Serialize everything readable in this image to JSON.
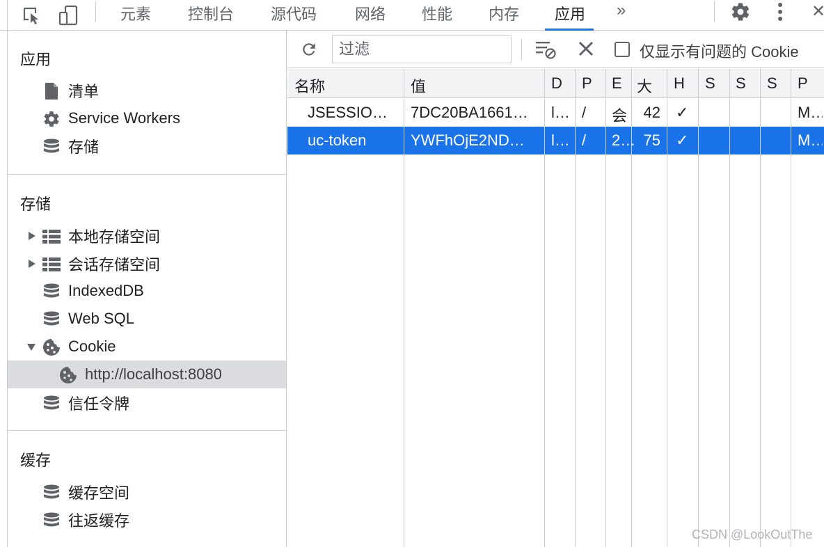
{
  "topbar": {
    "tabs": [
      "元素",
      "控制台",
      "源代码",
      "网络",
      "性能",
      "内存",
      "应用"
    ],
    "active_tab": "应用",
    "more": "»",
    "close": "✕"
  },
  "sidebar": {
    "app_section": {
      "title": "应用",
      "items": [
        {
          "label": "清单",
          "icon": "document-icon"
        },
        {
          "label": "Service Workers",
          "icon": "gear-icon"
        },
        {
          "label": "存储",
          "icon": "database-icon"
        }
      ]
    },
    "storage_section": {
      "title": "存储",
      "items": [
        {
          "label": "本地存储空间",
          "icon": "table-icon",
          "expander": "collapsed"
        },
        {
          "label": "会话存储空间",
          "icon": "table-icon",
          "expander": "collapsed"
        },
        {
          "label": "IndexedDB",
          "icon": "database-icon"
        },
        {
          "label": "Web SQL",
          "icon": "database-icon"
        },
        {
          "label": "Cookie",
          "icon": "cookie-icon",
          "expander": "expanded"
        },
        {
          "label": "http://localhost:8080",
          "icon": "cookie-icon",
          "selected": true
        },
        {
          "label": "信任令牌",
          "icon": "database-icon"
        }
      ]
    },
    "cache_section": {
      "title": "缓存",
      "items": [
        {
          "label": "缓存空间",
          "icon": "database-icon"
        },
        {
          "label": "往返缓存",
          "icon": "database-icon"
        }
      ]
    }
  },
  "toolbar": {
    "filter_placeholder": "过滤",
    "only_issues_label": "仅显示有问题的 Cookie"
  },
  "table": {
    "columns": [
      "名称",
      "值",
      "D",
      "P",
      "E",
      "大",
      "H",
      "S",
      "S",
      "S",
      "P"
    ],
    "rows": [
      {
        "name": "JSESSIO…",
        "value": "7DC20BA1661…",
        "domain": "l…",
        "path": "/",
        "expires": "会",
        "size": "42",
        "httponly": "✓",
        "s1": "",
        "s2": "",
        "s3": "",
        "priority": "M…",
        "selected": false
      },
      {
        "name": "uc-token",
        "value": "YWFhOjE2ND…",
        "domain": "l…",
        "path": "/",
        "expires": "2…",
        "size": "75",
        "httponly": "✓",
        "s1": "",
        "s2": "",
        "s3": "",
        "priority": "M…",
        "selected": true
      }
    ]
  },
  "colors": {
    "accent": "#1a73e8",
    "selected_sidebar": "#dadce0",
    "header_bg": "#f1f3f4",
    "border": "#cacdd1",
    "icon": "#5f6368"
  },
  "watermark": "CSDN @LookOutThe"
}
